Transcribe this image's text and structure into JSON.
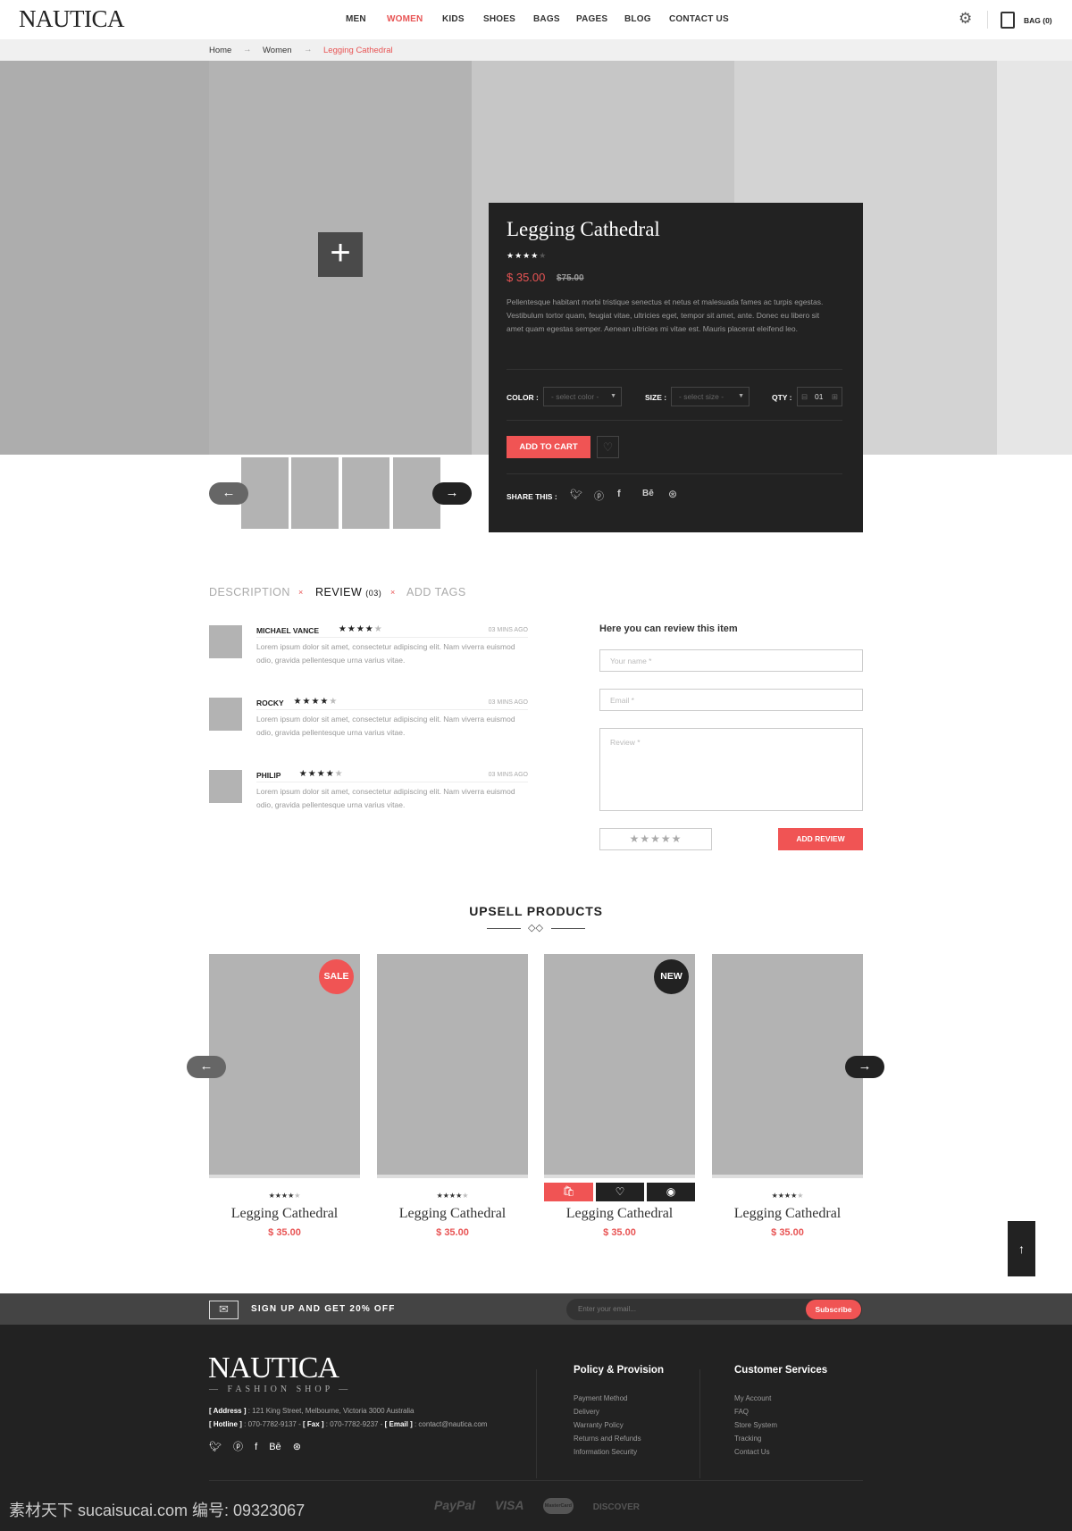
{
  "header": {
    "logo": "NAUTICA",
    "nav": [
      "MEN",
      "WOMEN",
      "KIDS",
      "SHOES",
      "BAGS",
      "PAGES",
      "BLOG",
      "CONTACT US"
    ],
    "active_nav": "WOMEN",
    "bag_label": "BAG (0)"
  },
  "breadcrumb": [
    "Home",
    "Women",
    "Legging Cathedral"
  ],
  "colors": {
    "accent": "#f05454",
    "dark": "#222222",
    "placeholder": "#b3b3b3"
  },
  "product": {
    "title": "Legging Cathedral",
    "rating": 4,
    "max_rating": 5,
    "price": "$ 35.00",
    "old_price": "$75.00",
    "description": "Pellentesque habitant morbi tristique senectus et netus et malesuada fames ac turpis egestas. Vestibulum tortor quam, feugiat vitae, ultricies eget, tempor sit amet, ante. Donec eu libero sit amet quam egestas semper. Aenean ultricies mi vitae est. Mauris placerat eleifend leo.",
    "color_label": "COLOR :",
    "color_placeholder": "- select color -",
    "size_label": "SIZE :",
    "size_placeholder": "- select size -",
    "qty_label": "QTY :",
    "qty": "01",
    "add_to_cart": "ADD TO CART",
    "share_label": "SHARE THIS :",
    "share_icons": [
      "twitter",
      "pinterest",
      "facebook",
      "behance",
      "dribbble"
    ]
  },
  "tabs": {
    "description": "DESCRIPTION",
    "review": "REVIEW",
    "review_count": "(03)",
    "tags": "ADD TAGS",
    "separator": "×"
  },
  "reviews": [
    {
      "name": "MICHAEL VANCE",
      "rating": 4,
      "time": "03 MINS AGO",
      "text": "Lorem ipsum dolor sit amet, consectetur adipiscing elit. Nam viverra euismod odio, gravida pellentesque urna varius vitae."
    },
    {
      "name": "ROCKY",
      "rating": 4,
      "time": "03 MINS AGO",
      "text": "Lorem ipsum dolor sit amet, consectetur adipiscing elit. Nam viverra euismod odio, gravida pellentesque urna varius vitae."
    },
    {
      "name": "PHILIP",
      "rating": 4,
      "time": "03 MINS AGO",
      "text": "Lorem ipsum dolor sit amet, consectetur adipiscing elit. Nam viverra euismod odio, gravida pellentesque urna varius vitae."
    }
  ],
  "review_form": {
    "title": "Here you can review this item",
    "name_placeholder": "Your name *",
    "email_placeholder": "Email *",
    "review_placeholder": "Review *",
    "submit": "ADD REVIEW",
    "rating": 0
  },
  "upsell": {
    "title": "UPSELL PRODUCTS",
    "products": [
      {
        "title": "Legging Cathedral",
        "price": "$ 35.00",
        "rating": 4,
        "badge": "SALE"
      },
      {
        "title": "Legging Cathedral",
        "price": "$ 35.00",
        "rating": 4,
        "badge": ""
      },
      {
        "title": "Legging Cathedral",
        "price": "$ 35.00",
        "rating": 4,
        "badge": "NEW"
      },
      {
        "title": "Legging Cathedral",
        "price": "$ 35.00",
        "rating": 4,
        "badge": ""
      }
    ]
  },
  "newsletter": {
    "text": "SIGN UP AND GET 20% OFF",
    "placeholder": "Enter your email...",
    "button": "Subscribe"
  },
  "footer": {
    "logo": "NAUTICA",
    "tagline": "FASHION SHOP",
    "address_label": "[ Address ]",
    "address": ": 121 King Street, Melbourne, Victoria 3000 Australia",
    "hotline_label": "[ Hotline ]",
    "hotline": ": 070-7782-9137  -",
    "fax_label": "[ Fax ]",
    "fax": ": 070-7782-9237  -",
    "email_label": "[ Email ]",
    "email": ": contact@nautica.com",
    "policy_title": "Policy & Provision",
    "policy_links": [
      "Payment Method",
      "Delivery",
      "Warranty Policy",
      "Returns and Refunds",
      "Information Security"
    ],
    "service_title": "Customer Services",
    "service_links": [
      "My Account",
      "FAQ",
      "Store System",
      "Tracking",
      "Contact Us"
    ],
    "payments": [
      "PayPal",
      "VISA",
      "MasterCard",
      "DISCOVER"
    ]
  },
  "watermark": "素材天下 sucaisucai.com  编号: 09323067"
}
